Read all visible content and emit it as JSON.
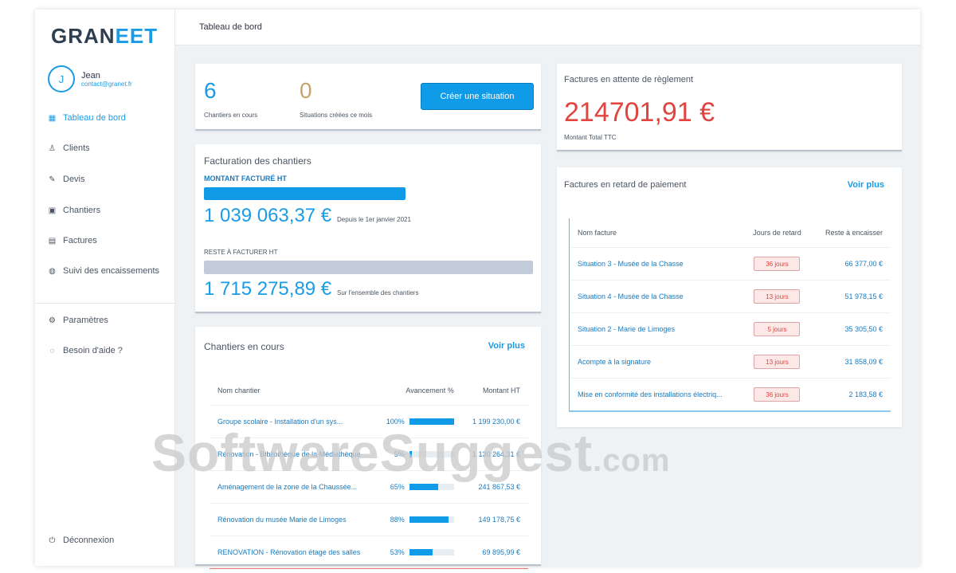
{
  "app": {
    "logo_a": "GRAN",
    "logo_b": "EET"
  },
  "user": {
    "initial": "J",
    "name": "Jean",
    "email": "contact@granet.fr"
  },
  "sidebar": {
    "items": [
      {
        "label": "Tableau de bord",
        "icon": "dashboard-icon"
      },
      {
        "label": "Clients",
        "icon": "users-icon"
      },
      {
        "label": "Devis",
        "icon": "quote-icon"
      },
      {
        "label": "Chantiers",
        "icon": "project-icon"
      },
      {
        "label": "Factures",
        "icon": "invoice-icon"
      },
      {
        "label": "Suivi des encaissements",
        "icon": "payments-icon"
      }
    ],
    "bottom": [
      {
        "label": "Paramètres"
      },
      {
        "label": "Besoin d'aide ?"
      }
    ],
    "logout": "Déconnexion"
  },
  "header": {
    "title": "Tableau de bord"
  },
  "stats": {
    "projects_count": "6",
    "projects_label": "Chantiers en cours",
    "situations_count": "0",
    "situations_label": "Situations créées ce mois",
    "create_button": "Créer une situation"
  },
  "billing": {
    "title": "Facturation des chantiers",
    "billed_label": "MONTANT FACTURÉ HT",
    "billed_value": "1 039 063,37 €",
    "billed_note": "Depuis le 1er janvier 2021",
    "billed_fraction": 0.6,
    "remaining_label": "RESTE À FACTURER HT",
    "remaining_value": "1 715 275,89 €",
    "remaining_note": "Sur l'ensemble des chantiers"
  },
  "projects": {
    "title": "Chantiers en cours",
    "see_more": "Voir plus",
    "headers": [
      "Nom chantier",
      "Avancement %",
      "Montant HT"
    ],
    "rows": [
      {
        "name": "Groupe scolaire - Installation d'un sys...",
        "pct": "100%",
        "progress": 100,
        "amount": "1 199 230,00 €"
      },
      {
        "name": "Rénovation - Bibliothèque de la Médiathèque",
        "pct": "5%",
        "progress": 5,
        "amount": "1 130 264,31 €"
      },
      {
        "name": "Aménagement de la zone de la Chaussée...",
        "pct": "65%",
        "progress": 65,
        "amount": "241 867,53 €"
      },
      {
        "name": "Rénovation du musée Marie de Limoges",
        "pct": "88%",
        "progress": 88,
        "amount": "149 178,75 €"
      },
      {
        "name": "RENOVATION - Rénovation étage des salles",
        "pct": "53%",
        "progress": 53,
        "amount": "69 895,99 €"
      }
    ]
  },
  "pending": {
    "title": "Factures en attente de règlement",
    "value": "214701,91 €",
    "label": "Montant Total TTC"
  },
  "late": {
    "title": "Factures en retard de paiement",
    "see_more": "Voir plus",
    "headers": [
      "Nom facture",
      "Jours de retard",
      "Reste à encaisser"
    ],
    "rows": [
      {
        "name": "Situation 3 - Musée de la Chasse",
        "days": "36 jours",
        "amount": "66 377,00 €"
      },
      {
        "name": "Situation 4 - Musée de la Chasse",
        "days": "13 jours",
        "amount": "51 978,15 €"
      },
      {
        "name": "Situation 2 - Marie de Limoges",
        "days": "5 jours",
        "amount": "35 305,50 €"
      },
      {
        "name": "Acompte à la signature",
        "days": "13 jours",
        "amount": "31 858,09 €"
      },
      {
        "name": "Mise en conformité des installations électriq...",
        "days": "36 jours",
        "amount": "2 183,58 €"
      }
    ]
  },
  "watermark": {
    "text": "SoftwareSuggest",
    "suffix": ".com"
  },
  "colors": {
    "accent": "#1a9be6",
    "danger": "#e0443e"
  }
}
